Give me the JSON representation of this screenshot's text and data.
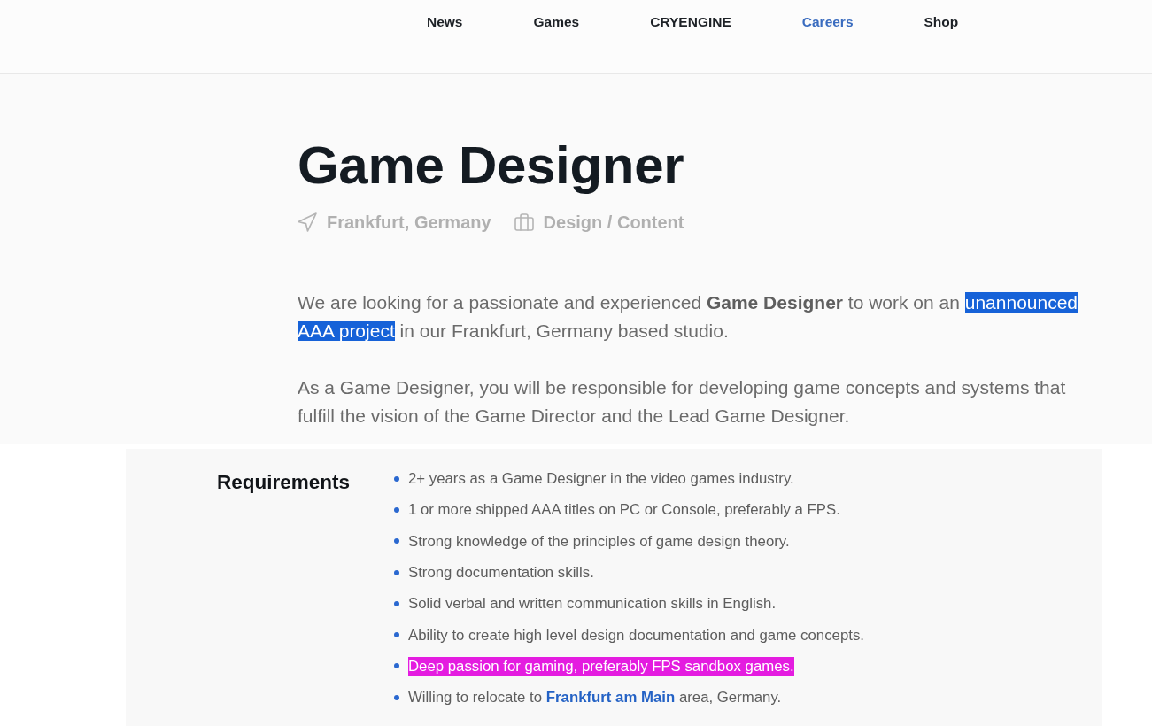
{
  "nav": {
    "items": [
      {
        "label": "News",
        "selected": false
      },
      {
        "label": "Games",
        "selected": false
      },
      {
        "label": "CRYENGINE",
        "selected": false
      },
      {
        "label": "Careers",
        "selected": true
      },
      {
        "label": "Shop",
        "selected": false
      }
    ]
  },
  "job": {
    "title": "Game Designer",
    "location": "Frankfurt, Germany",
    "department": "Design / Content"
  },
  "description": [
    {
      "segments": [
        {
          "kind": "text",
          "text": "We are looking for a passionate and experienced ",
          "selected": false
        },
        {
          "kind": "bold",
          "text": "Game Designer",
          "selected": false
        },
        {
          "kind": "text",
          "text": " to work on an ",
          "selected": false
        },
        {
          "kind": "text",
          "text": "unannounced AAA project",
          "selected": true
        },
        {
          "kind": "text",
          "text": " in our Frankfurt, Germany based studio.",
          "selected": false
        }
      ]
    },
    {
      "segments": [
        {
          "kind": "text",
          "text": "As a Game Designer, you will be responsible for developing game concepts and systems that fulfill the vision of the Game Director and the Lead Game Designer.",
          "selected": false
        }
      ]
    }
  ],
  "requirements": {
    "heading": "Requirements",
    "items": [
      {
        "highlighted": false,
        "segments": [
          {
            "kind": "text",
            "text": "2+ years as a Game Designer in the video games industry."
          }
        ]
      },
      {
        "highlighted": false,
        "segments": [
          {
            "kind": "text",
            "text": "1 or more shipped AAA titles on PC or Console, preferably a FPS."
          }
        ]
      },
      {
        "highlighted": false,
        "segments": [
          {
            "kind": "text",
            "text": "Strong knowledge of the principles of game design theory."
          }
        ]
      },
      {
        "highlighted": false,
        "segments": [
          {
            "kind": "text",
            "text": "Strong documentation skills."
          }
        ]
      },
      {
        "highlighted": false,
        "segments": [
          {
            "kind": "text",
            "text": "Solid verbal and written communication skills in English."
          }
        ]
      },
      {
        "highlighted": false,
        "segments": [
          {
            "kind": "text",
            "text": "Ability to create high level design documentation and game concepts."
          }
        ]
      },
      {
        "highlighted": true,
        "segments": [
          {
            "kind": "text",
            "text": "Deep passion for gaming, preferably FPS sandbox games."
          }
        ]
      },
      {
        "highlighted": false,
        "segments": [
          {
            "kind": "text",
            "text": "Willing to relocate to "
          },
          {
            "kind": "link",
            "text": "Frankfurt am Main"
          },
          {
            "kind": "text",
            "text": " area, Germany."
          }
        ]
      }
    ]
  }
}
